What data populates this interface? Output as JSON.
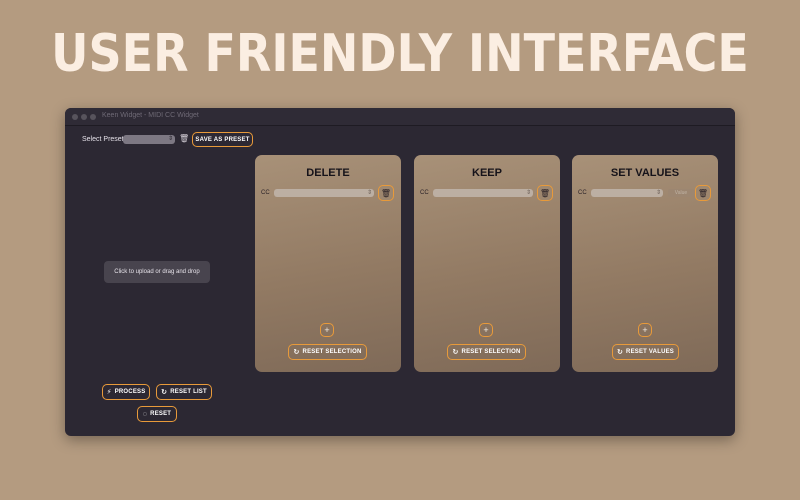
{
  "headline": "USER FRIENDLY INTERFACE",
  "window": {
    "title": "Keen Widget - MIDI CC Widget"
  },
  "preset": {
    "label": "Select Preset",
    "save_label": "SAVE AS PRESET"
  },
  "upload": {
    "text": "Click to upload or drag and drop"
  },
  "actions": {
    "process": "PROCESS",
    "reset_list": "RESET LIST",
    "reset": "RESET"
  },
  "cards": [
    {
      "title": "DELETE",
      "cc_label": "CC",
      "reset_label": "RESET SELECTION"
    },
    {
      "title": "KEEP",
      "cc_label": "CC",
      "reset_label": "RESET SELECTION"
    },
    {
      "title": "SET VALUES",
      "cc_label": "CC",
      "value_placeholder": "Value",
      "reset_label": "RESET VALUES"
    }
  ],
  "icons": {
    "trash": "trash-icon",
    "plus": "plus-icon",
    "bolt": "bolt-icon",
    "reset": "reset-icon"
  },
  "colors": {
    "background": "#b49b80",
    "window": "#2c2833",
    "accent": "#e89a3a",
    "headline": "#fbeee2"
  }
}
